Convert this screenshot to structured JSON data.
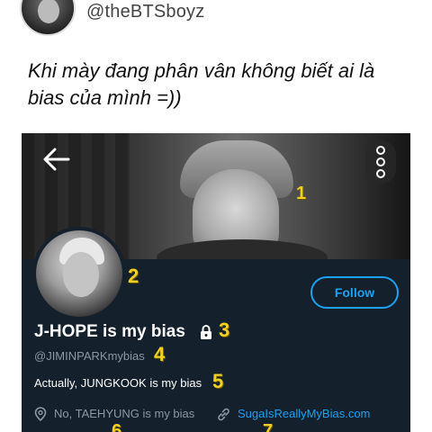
{
  "tweet": {
    "handle": "@theBTSboyz",
    "caption": "Khi mày đang phân vân không biết ai là bias của mình =))"
  },
  "profile": {
    "follow_label": "Follow",
    "display_name": "J-HOPE is my bias",
    "screen_name": "@JIMINPARKmybias",
    "bio": "Actually, JUNGKOOK is my bias",
    "location": "No, TAEHYUNG is my bias",
    "website": "SugaIsReallyMyBias.com"
  },
  "annotations": {
    "n1": "1",
    "n2": "2",
    "n3": "3",
    "n4": "4",
    "n5": "5",
    "n6": "6",
    "n7": "7"
  },
  "icons": {
    "back": "back-arrow-icon",
    "more": "more-vertical-icon",
    "lock": "lock-icon",
    "location": "location-pin-icon",
    "link": "link-icon"
  },
  "colors": {
    "profile_bg": "#14202b",
    "accent": "#1da1f2",
    "annotation": "#f2d021",
    "muted_text": "#8b98a5"
  }
}
